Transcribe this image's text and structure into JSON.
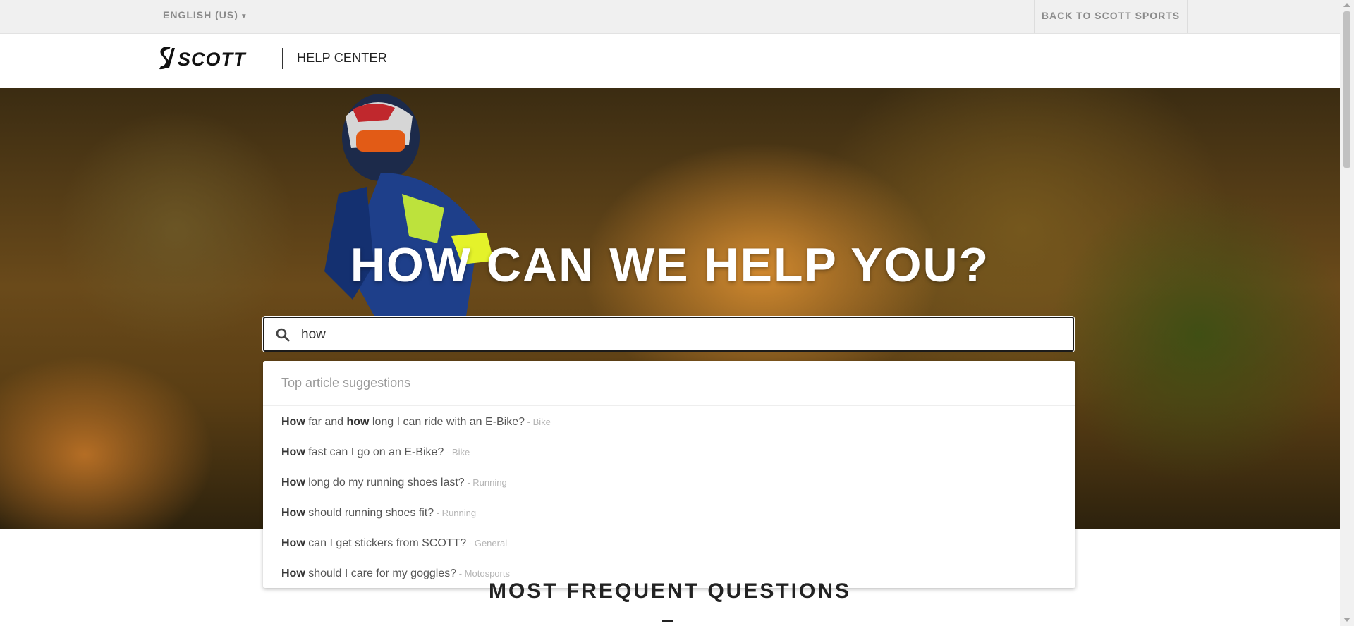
{
  "topbar": {
    "language": "ENGLISH (US)",
    "back_link": "BACK TO SCOTT SPORTS"
  },
  "header": {
    "logo_text": "SCOTT",
    "section": "HELP CENTER"
  },
  "hero": {
    "title": "HOW CAN WE HELP YOU?"
  },
  "search": {
    "value": "how",
    "placeholder": ""
  },
  "suggestions": {
    "heading": "Top article suggestions",
    "items": [
      {
        "pre": "How",
        "mid1": " far and ",
        "bold2": "how",
        "rest": " long I can ride with an E-Bike?",
        "category": " - Bike"
      },
      {
        "pre": "How",
        "rest": " fast can I go on an E-Bike?",
        "category": " - Bike"
      },
      {
        "pre": "How",
        "rest": " long do my running shoes last?",
        "category": " - Running"
      },
      {
        "pre": "How",
        "rest": " should running shoes fit?",
        "category": " - Running"
      },
      {
        "pre": "How",
        "rest": " can I get stickers from SCOTT?",
        "category": " - General"
      },
      {
        "pre": "How",
        "rest": " should I care for my goggles?",
        "category": " - Motosports"
      }
    ]
  },
  "faq": {
    "title": "MOST FREQUENT QUESTIONS"
  },
  "colors": {
    "topbar_bg": "#f0f0f0",
    "text_muted": "#8a8a8a",
    "search_border": "#1b1b1b"
  }
}
